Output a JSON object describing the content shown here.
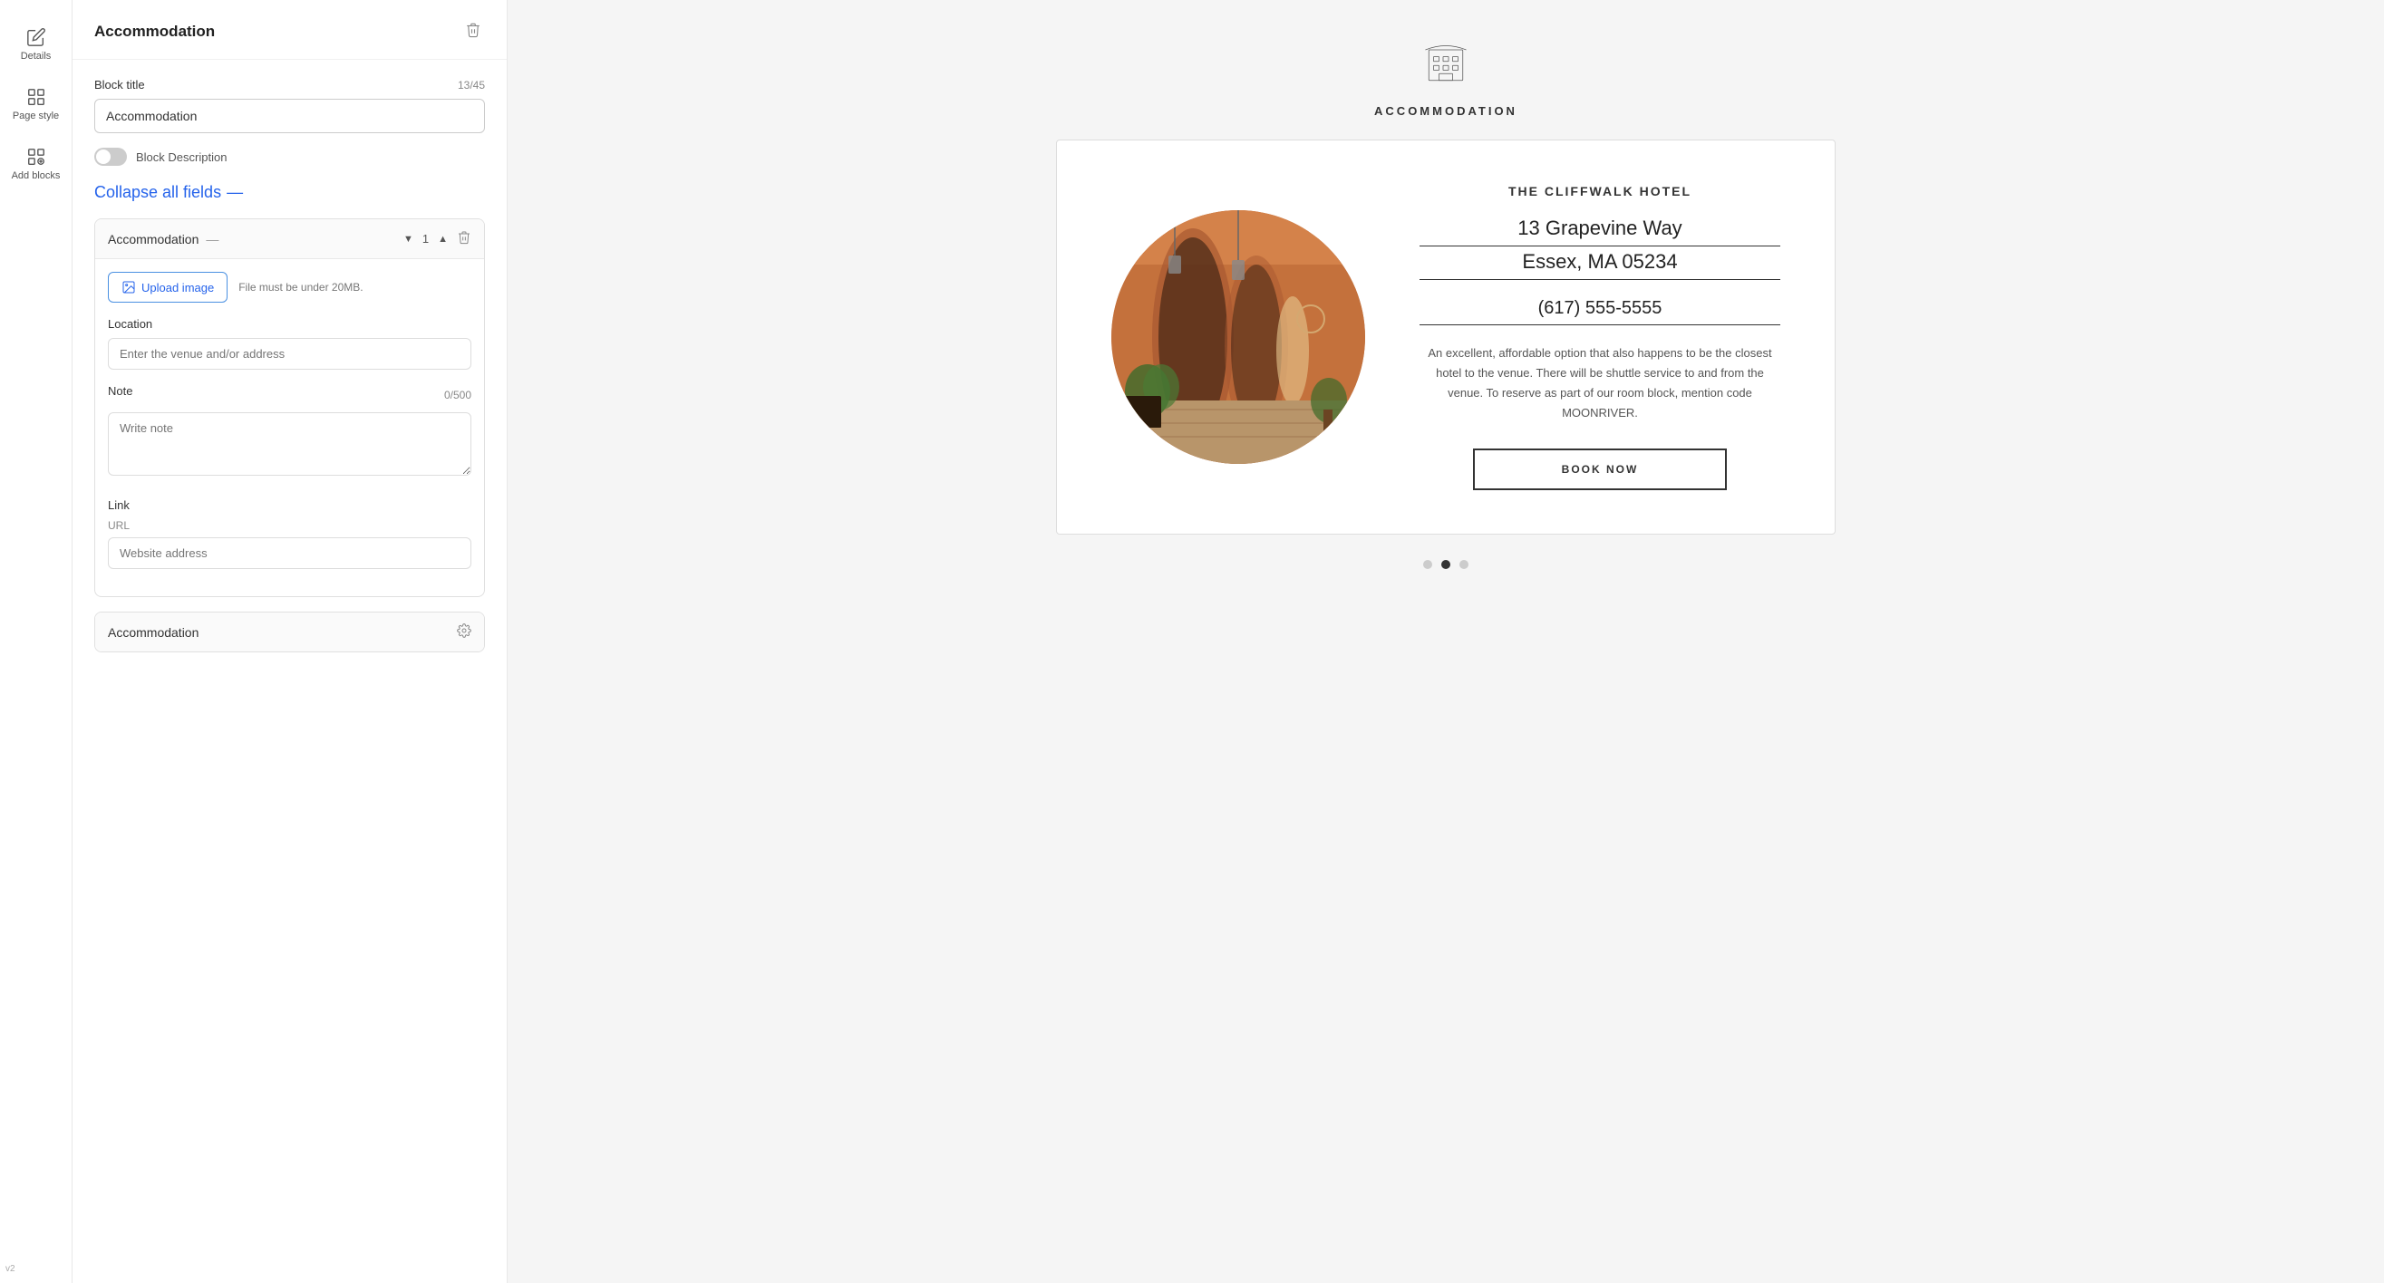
{
  "sidebar": {
    "items": [
      {
        "label": "Details",
        "icon": "pencil-icon"
      },
      {
        "label": "Page style",
        "icon": "palette-icon"
      },
      {
        "label": "Add blocks",
        "icon": "plus-block-icon"
      }
    ]
  },
  "panel": {
    "title": "Accommodation",
    "block_title_label": "Block title",
    "char_count": "13/45",
    "block_title_value": "Accommodation",
    "block_description_label": "Block Description",
    "collapse_label": "Collapse all fields",
    "accommodation_item_label": "Accommodation",
    "item_count": "1",
    "upload_label": "Upload image",
    "upload_hint": "File must be under 20MB.",
    "location_label": "Location",
    "location_placeholder": "Enter the venue and/or address",
    "note_label": "Note",
    "note_char_count": "0/500",
    "note_placeholder": "Write note",
    "link_label": "Link",
    "url_label": "URL",
    "url_placeholder": "Website address",
    "accommodation_2_label": "Accommodation"
  },
  "preview": {
    "section_title": "ACCOMMODATION",
    "hotel_name": "THE CLIFFWALK HOTEL",
    "address_line1": "13 Grapevine Way",
    "address_line2": "Essex, MA 05234",
    "phone": "(617) 555-5555",
    "description": "An excellent, affordable option that also happens to be the closest hotel to the venue. There will be shuttle service to and from the venue. To reserve as part of our room block, mention code MOONRIVER.",
    "book_btn": "BOOK NOW",
    "dots": [
      false,
      true,
      false
    ]
  },
  "version": "v2"
}
